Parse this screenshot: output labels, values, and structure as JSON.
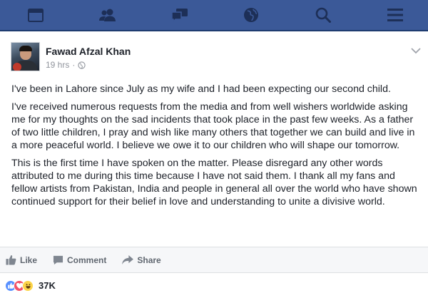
{
  "nav": {
    "items": [
      "news-feed-icon",
      "friends-icon",
      "messages-icon",
      "notifications-globe-icon",
      "search-icon",
      "menu-icon"
    ]
  },
  "post": {
    "author": "Fawad Afzal Khan",
    "timestamp": "19 hrs",
    "separator": "·",
    "privacy_icon": "globe-icon",
    "paragraphs": [
      "I've been in Lahore since July as my wife and I had been expecting our second child.",
      "I've received numerous requests from the media and from well wishers worldwide asking me for my thoughts on the sad incidents that took place in the past few weeks. As a father of two little children, I pray and wish like many others that together we can build and live in a more peaceful world. I believe we owe it to our children who will shape our tomorrow.",
      "This is the first time I have spoken on the matter. Please disregard any other words attributed to me during this time because I have not said them. I thank all my fans and fellow artists from Pakistan, India and people in general all over the world who have shown continued support for their belief in love and understanding to unite a divisive world."
    ]
  },
  "actions": {
    "like": "Like",
    "comment": "Comment",
    "share": "Share"
  },
  "reactions": {
    "types": [
      "like",
      "love",
      "haha"
    ],
    "count": "37K"
  },
  "colors": {
    "brand": "#3b5998",
    "text": "#1d2129",
    "muted": "#90949c"
  }
}
